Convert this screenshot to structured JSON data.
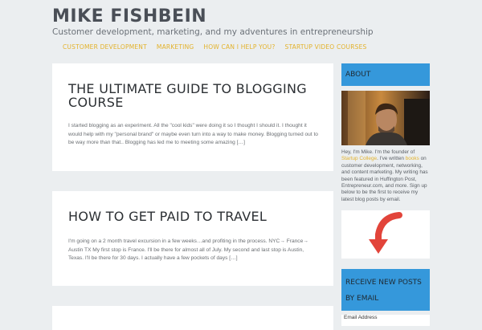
{
  "site": {
    "title": "MIKE FISHBEIN",
    "tagline": "Customer development, marketing, and my adventures in entrepreneurship"
  },
  "nav": {
    "items": [
      {
        "label": "CUSTOMER DEVELOPMENT"
      },
      {
        "label": "MARKETING"
      },
      {
        "label": "HOW CAN I HELP YOU?"
      },
      {
        "label": "STARTUP VIDEO COURSES"
      }
    ]
  },
  "posts": [
    {
      "title": "THE ULTIMATE GUIDE TO BLOGGING COURSE",
      "excerpt": "I started blogging as an experiment. All the \"cool kids\" were doing it so I thought I should it. I thought it would help with my \"personal brand\" or maybe even turn into a way to make money. Blogging turned out to be way more than that.. Blogging has led me to meeting some amazing […]"
    },
    {
      "title": "HOW TO GET PAID TO TRAVEL",
      "excerpt": "I'm going on a 2 month travel excursion in a few weeks…and profiting in the process. NYC→ France→ Austin TX My first stop is France. I'll be there for almost all of July. My second and last stop is Austin, Texas. I'll be there for 30 days. I actually have a few pockets of days […]"
    }
  ],
  "sidebar": {
    "about_title": "ABOUT",
    "about": {
      "t1": "Hey, I'm Mike. I'm the founder of ",
      "link1": "Startup College",
      "t2": ". I've written ",
      "link2": "books",
      "t3": " on customer development, networking, and content marketing. My writing has been featured in Huffington Post, Entrepreneur.com, and more. Sign up below to be the first to receive my latest blog posts by email."
    },
    "subscribe_title": "RECEIVE NEW POSTS BY EMAIL",
    "email_label": "Email Address"
  },
  "colors": {
    "accent": "#e3b22b",
    "widget_blue": "#3598db",
    "arrow_red": "#e2443a",
    "background": "#ebeef0"
  },
  "icons": {
    "arrow": "curved-down-arrow-icon"
  }
}
